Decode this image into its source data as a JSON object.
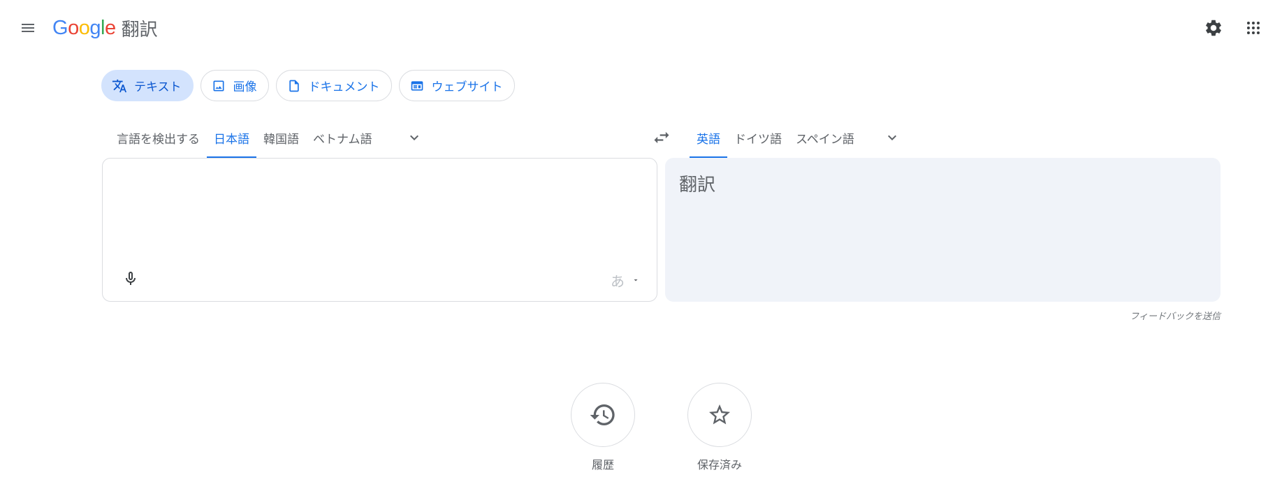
{
  "header": {
    "logo_letters": [
      {
        "char": "G",
        "color": "#4285F4"
      },
      {
        "char": "o",
        "color": "#EA4335"
      },
      {
        "char": "o",
        "color": "#FBBC05"
      },
      {
        "char": "g",
        "color": "#4285F4"
      },
      {
        "char": "l",
        "color": "#34A853"
      },
      {
        "char": "e",
        "color": "#EA4335"
      }
    ],
    "product_name": "翻訳",
    "icons": {
      "menu": "hamburger-menu-icon",
      "settings": "gear-icon",
      "apps": "grid-apps-icon"
    }
  },
  "modes": [
    {
      "label": "テキスト",
      "icon": "translate-icon",
      "active": true
    },
    {
      "label": "画像",
      "icon": "image-icon",
      "active": false
    },
    {
      "label": "ドキュメント",
      "icon": "document-icon",
      "active": false
    },
    {
      "label": "ウェブサイト",
      "icon": "website-icon",
      "active": false
    }
  ],
  "source_languages": [
    {
      "label": "言語を検出する",
      "active": false
    },
    {
      "label": "日本語",
      "active": true
    },
    {
      "label": "韓国語",
      "active": false
    },
    {
      "label": "ベトナム語",
      "active": false
    }
  ],
  "target_languages": [
    {
      "label": "英語",
      "active": true
    },
    {
      "label": "ドイツ語",
      "active": false
    },
    {
      "label": "スペイン語",
      "active": false
    }
  ],
  "source": {
    "value": "",
    "ime_char": "あ"
  },
  "target": {
    "placeholder": "翻訳"
  },
  "feedback_label": "フィードバックを送信",
  "actions": {
    "history_label": "履歴",
    "saved_label": "保存済み"
  },
  "colors": {
    "accent": "#1a73e8",
    "active_chip": "#d3e3fd",
    "target_panel": "#f0f3f9"
  }
}
